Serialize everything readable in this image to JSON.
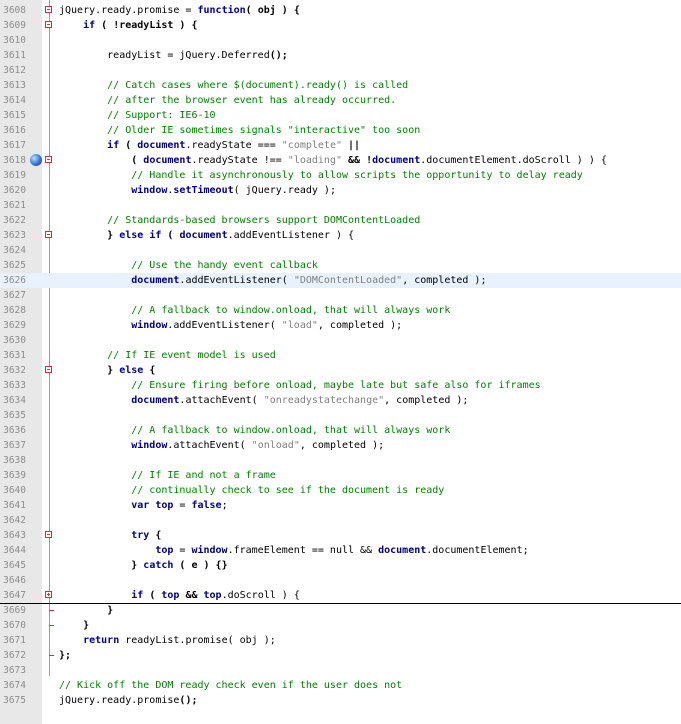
{
  "editor": {
    "lines": [
      {
        "num": "3608",
        "fold": "minus",
        "segs": [
          [
            "jQuery.ready.promise = ",
            ""
          ],
          [
            "function",
            "kw"
          ],
          [
            "( obj ) {",
            "op"
          ]
        ]
      },
      {
        "num": "3609",
        "fold": "minus",
        "segs": [
          [
            "    ",
            ""
          ],
          [
            "if",
            "kw"
          ],
          [
            " ( !readyList ) {",
            "op"
          ]
        ]
      },
      {
        "num": "3610",
        "segs": []
      },
      {
        "num": "3611",
        "segs": [
          [
            "        readyList = jQuery.Deferred",
            ""
          ],
          [
            "();",
            "op"
          ]
        ]
      },
      {
        "num": "3612",
        "segs": []
      },
      {
        "num": "3613",
        "segs": [
          [
            "        // Catch cases where $(document).ready() is called",
            "cm"
          ]
        ]
      },
      {
        "num": "3614",
        "segs": [
          [
            "        // after the browser event has already occurred.",
            "cm"
          ]
        ]
      },
      {
        "num": "3615",
        "segs": [
          [
            "        // Support: IE6-10",
            "cm"
          ]
        ]
      },
      {
        "num": "3616",
        "segs": [
          [
            "        // Older IE sometimes signals \"interactive\" too soon",
            "cm"
          ]
        ]
      },
      {
        "num": "3617",
        "segs": [
          [
            "        ",
            ""
          ],
          [
            "if",
            "kw"
          ],
          [
            " ( ",
            "op"
          ],
          [
            "document",
            "mm"
          ],
          [
            ".readyState === ",
            ""
          ],
          [
            "\"complete\"",
            "st"
          ],
          [
            " ||",
            "op"
          ]
        ]
      },
      {
        "num": "3618",
        "fold": "minus",
        "bookmark": true,
        "segs": [
          [
            "            ( ",
            "op"
          ],
          [
            "document",
            "mm"
          ],
          [
            ".readyState !== ",
            ""
          ],
          [
            "\"loading\"",
            "st"
          ],
          [
            " && !",
            "op"
          ],
          [
            "document",
            "mm"
          ],
          [
            ".documentElement.doScroll ) ) {",
            ""
          ]
        ]
      },
      {
        "num": "3619",
        "segs": [
          [
            "            // Handle it asynchronously to allow scripts the opportunity to delay ready",
            "cm"
          ]
        ]
      },
      {
        "num": "3620",
        "segs": [
          [
            "            ",
            ""
          ],
          [
            "window",
            "mm"
          ],
          [
            ".",
            ""
          ],
          [
            "setTimeout",
            "mm"
          ],
          [
            "( jQuery.ready );",
            ""
          ]
        ]
      },
      {
        "num": "3621",
        "segs": []
      },
      {
        "num": "3622",
        "segs": [
          [
            "        // Standards-based browsers support DOMContentLoaded",
            "cm"
          ]
        ]
      },
      {
        "num": "3623",
        "fold": "minus",
        "segs": [
          [
            "        } ",
            "op"
          ],
          [
            "else if",
            "kw"
          ],
          [
            " ( ",
            "op"
          ],
          [
            "document",
            "mm"
          ],
          [
            ".addEventListener ) {",
            ""
          ]
        ]
      },
      {
        "num": "3624",
        "segs": []
      },
      {
        "num": "3625",
        "segs": [
          [
            "            // Use the handy event callback",
            "cm"
          ]
        ]
      },
      {
        "num": "3626",
        "hl": true,
        "segs": [
          [
            "            ",
            ""
          ],
          [
            "document",
            "mm"
          ],
          [
            ".addEventListener( ",
            ""
          ],
          [
            "\"DOMContentLoaded\"",
            "st"
          ],
          [
            ", completed );",
            ""
          ]
        ]
      },
      {
        "num": "3627",
        "segs": []
      },
      {
        "num": "3628",
        "segs": [
          [
            "            // A fallback to window.onload, that will always work",
            "cm"
          ]
        ]
      },
      {
        "num": "3629",
        "segs": [
          [
            "            ",
            ""
          ],
          [
            "window",
            "mm"
          ],
          [
            ".addEventListener( ",
            ""
          ],
          [
            "\"load\"",
            "st"
          ],
          [
            ", completed );",
            ""
          ]
        ]
      },
      {
        "num": "3630",
        "segs": []
      },
      {
        "num": "3631",
        "segs": [
          [
            "        // If IE event model is used",
            "cm"
          ]
        ]
      },
      {
        "num": "3632",
        "fold": "minus",
        "segs": [
          [
            "        } ",
            "op"
          ],
          [
            "else",
            "kw"
          ],
          [
            " {",
            "op"
          ]
        ]
      },
      {
        "num": "3633",
        "segs": [
          [
            "            // Ensure firing before onload, maybe late but safe also for iframes",
            "cm"
          ]
        ]
      },
      {
        "num": "3634",
        "segs": [
          [
            "            ",
            ""
          ],
          [
            "document",
            "mm"
          ],
          [
            ".attachEvent( ",
            ""
          ],
          [
            "\"onreadystatechange\"",
            "st"
          ],
          [
            ", completed );",
            ""
          ]
        ]
      },
      {
        "num": "3635",
        "segs": []
      },
      {
        "num": "3636",
        "segs": [
          [
            "            // A fallback to window.onload, that will always work",
            "cm"
          ]
        ]
      },
      {
        "num": "3637",
        "segs": [
          [
            "            ",
            ""
          ],
          [
            "window",
            "mm"
          ],
          [
            ".attachEvent( ",
            ""
          ],
          [
            "\"onload\"",
            "st"
          ],
          [
            ", completed );",
            ""
          ]
        ]
      },
      {
        "num": "3638",
        "segs": []
      },
      {
        "num": "3639",
        "segs": [
          [
            "            // If IE and not a frame",
            "cm"
          ]
        ]
      },
      {
        "num": "3640",
        "segs": [
          [
            "            // continually check to see if the document is ready",
            "cm"
          ]
        ]
      },
      {
        "num": "3641",
        "segs": [
          [
            "            ",
            ""
          ],
          [
            "var",
            "kw"
          ],
          [
            " ",
            ""
          ],
          [
            "top",
            "mm"
          ],
          [
            " = ",
            ""
          ],
          [
            "false",
            "kw"
          ],
          [
            ";",
            ""
          ]
        ]
      },
      {
        "num": "3642",
        "segs": []
      },
      {
        "num": "3643",
        "fold": "minus",
        "segs": [
          [
            "            ",
            ""
          ],
          [
            "try",
            "kw"
          ],
          [
            " {",
            "op"
          ]
        ]
      },
      {
        "num": "3644",
        "segs": [
          [
            "                ",
            ""
          ],
          [
            "top",
            "mm"
          ],
          [
            " = ",
            ""
          ],
          [
            "window",
            "mm"
          ],
          [
            ".frameElement == null && ",
            ""
          ],
          [
            "document",
            "mm"
          ],
          [
            ".documentElement;",
            ""
          ]
        ]
      },
      {
        "num": "3645",
        "segs": [
          [
            "            } ",
            "op"
          ],
          [
            "catch",
            "kw"
          ],
          [
            " ( e ) {}",
            "op"
          ]
        ]
      },
      {
        "num": "3646",
        "segs": []
      },
      {
        "num": "3647",
        "fold": "plus",
        "lastfold": true,
        "segs": [
          [
            "            ",
            ""
          ],
          [
            "if",
            "kw"
          ],
          [
            " ( ",
            "op"
          ],
          [
            "top",
            "mm"
          ],
          [
            " && ",
            "op"
          ],
          [
            "top",
            "mm"
          ],
          [
            ".doScroll ) {",
            ""
          ]
        ]
      },
      {
        "num": "3669",
        "foldend": true,
        "segs": [
          [
            "        }",
            "op"
          ]
        ]
      },
      {
        "num": "3670",
        "foldend": true,
        "segs": [
          [
            "    }",
            "op"
          ]
        ]
      },
      {
        "num": "3671",
        "segs": [
          [
            "    ",
            ""
          ],
          [
            "return",
            "kw"
          ],
          [
            " readyList.promise( obj );",
            ""
          ]
        ]
      },
      {
        "num": "3672",
        "foldend": true,
        "segs": [
          [
            "};",
            "op"
          ]
        ]
      },
      {
        "num": "3673",
        "segs": []
      },
      {
        "num": "3674",
        "segs": [
          [
            "// Kick off the DOM ready check even if the user does not",
            "cm"
          ]
        ]
      },
      {
        "num": "3675",
        "segs": [
          [
            "jQuery.ready.promise",
            ""
          ],
          [
            "();",
            "op"
          ]
        ]
      }
    ]
  }
}
